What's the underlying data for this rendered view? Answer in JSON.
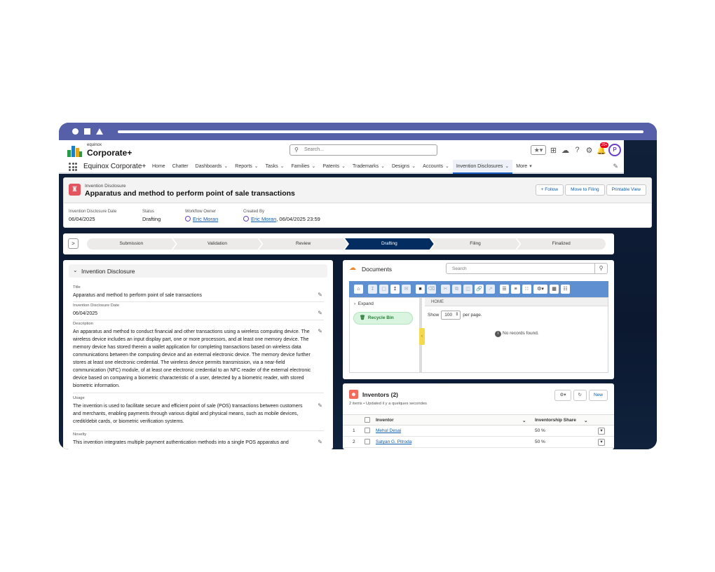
{
  "header": {
    "brand_small": "equinox",
    "brand_big": "Corporate+",
    "search_placeholder": "Search...",
    "notif_count": "20+",
    "avatar_initial": "P"
  },
  "nav": {
    "app_name": "Equinox Corporate+",
    "items": [
      {
        "label": "Home",
        "chev": false
      },
      {
        "label": "Chatter",
        "chev": false
      },
      {
        "label": "Dashboards",
        "chev": true
      },
      {
        "label": "Reports",
        "chev": true
      },
      {
        "label": "Tasks",
        "chev": true
      },
      {
        "label": "Families",
        "chev": true
      },
      {
        "label": "Patents",
        "chev": true
      },
      {
        "label": "Trademarks",
        "chev": true
      },
      {
        "label": "Designs",
        "chev": true
      },
      {
        "label": "Accounts",
        "chev": true
      },
      {
        "label": "Invention Disclosures",
        "chev": true,
        "active": true
      },
      {
        "label": "More",
        "chev": true
      }
    ]
  },
  "record": {
    "type": "Invention Disclosure",
    "title": "Apparatus and method to perform point of sale transactions",
    "buttons": {
      "follow": "+ Follow",
      "move": "Move to Filing",
      "print": "Printable View"
    },
    "highlights": {
      "date_label": "Invention Disclosure Date",
      "date_value": "06/04/2025",
      "status_label": "Status",
      "status_value": "Drafting",
      "owner_label": "Workflow Owner",
      "owner_value": "Eric Moran",
      "created_label": "Created By",
      "created_name": "Eric Moran",
      "created_date": ", 06/04/2025 23:59"
    }
  },
  "path": {
    "toggle": ">",
    "stages": [
      "Submission",
      "Validation",
      "Review",
      "Drafting",
      "Filing",
      "Finalized"
    ],
    "current": "Drafting"
  },
  "details": {
    "section_title": "Invention Disclosure",
    "fields": {
      "title_label": "Title",
      "title_value": "Apparatus and method to perform point of sale transactions",
      "date_label": "Invention Disclosure Date",
      "date_value": "06/04/2025",
      "desc_label": "Description",
      "desc_value": "An apparatus and method to conduct financial and other transactions using a wireless computing device. The wireless device includes an input display part, one or more processors, and at least one memory device. The memory device has stored therein a wallet application for completing transactions based on wireless data communications between the computing device and an external electronic device. The memory device further stores at least one electronic credential. The wireless device permits transmission, via a near-field communication (NFC) module, of at least one electronic credential to an NFC reader of the external electronic device based on comparing a biometric characteristic of a user, detected by a biometric reader, with stored biometric information.",
      "usage_label": "Usage",
      "usage_value": "The invention is used to facilitate secure and efficient point of sale (POS) transactions between customers and merchants, enabling payments through various digital and physical means, such as mobile devices, credit/debit cards, or biometric verification systems.",
      "novelty_label": "Novelty",
      "novelty_value": "This invention integrates multiple payment authentication methods into a single POS apparatus and"
    }
  },
  "documents": {
    "title": "Documents",
    "search_placeholder": "Search",
    "expand": "Expand",
    "recycle": "Recycle Bin",
    "home": "HOME",
    "show": "Show",
    "per_page_value": "100",
    "per_page": "per page.",
    "no_records": "No records found."
  },
  "inventors": {
    "title": "Inventors (2)",
    "subtitle": "2 items • Updated il y a quelques secondes",
    "new_button": "New",
    "col_inventor": "Inventor",
    "col_share": "Inventorship Share",
    "rows": [
      {
        "num": "1",
        "name": "Mehul Desai",
        "share": "50 %"
      },
      {
        "num": "2",
        "name": "Satyan G. Pitroda",
        "share": "50 %"
      }
    ]
  },
  "colors": {
    "chrome": "#5560a8",
    "brand_blue": "#0b5cab",
    "path_current": "#032d60",
    "record_icon": "#e3545f"
  }
}
